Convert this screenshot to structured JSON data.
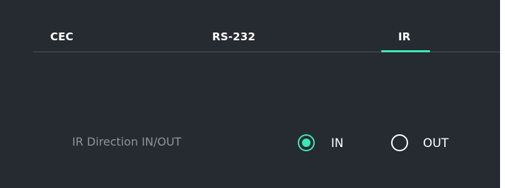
{
  "tabs": [
    {
      "label": "CEC",
      "active": false
    },
    {
      "label": "RS-232",
      "active": false
    },
    {
      "label": "IR",
      "active": true
    }
  ],
  "ir_direction": {
    "label": "IR Direction IN/OUT",
    "options": [
      {
        "label": "IN",
        "selected": true
      },
      {
        "label": "OUT",
        "selected": false
      }
    ]
  },
  "colors": {
    "background": "#262a31",
    "accent": "#3ee7b7",
    "label_text": "#8f939a",
    "divider": "#4c5159"
  }
}
